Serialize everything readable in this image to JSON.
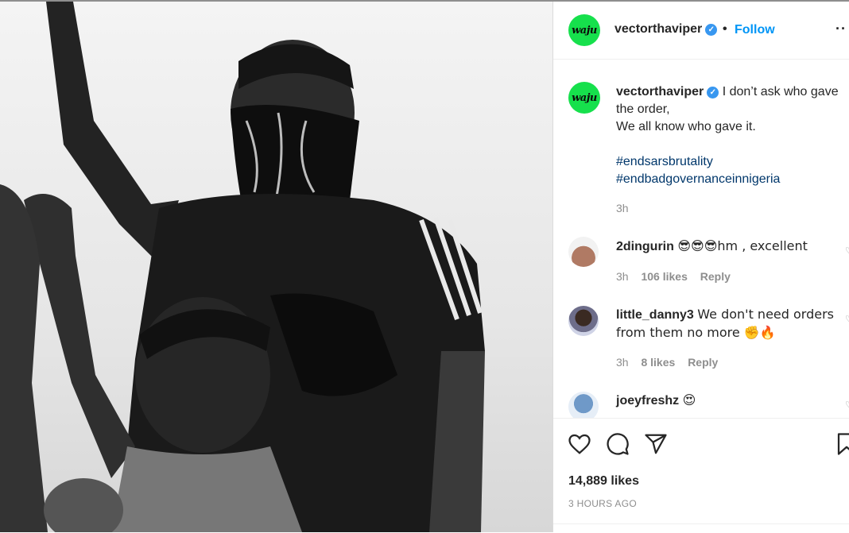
{
  "post": {
    "username": "vectorthaviper",
    "avatar_text": "waju",
    "follow_label": "Follow",
    "separator": "•",
    "more_label": "··",
    "caption": {
      "line1": "I don’t ask who gave the order,",
      "line2": "We all know who gave it.",
      "hashtags": [
        "#endsarsbrutality",
        "#endbadgovernanceinnigeria"
      ],
      "time": "3h"
    },
    "comments": [
      {
        "username": "2dingurin",
        "text": "😎😎😎hm , excellent",
        "time": "3h",
        "likes": "106 likes",
        "reply": "Reply"
      },
      {
        "username": "little_danny3",
        "text": "We don't need orders from them no more ✊🔥",
        "time": "3h",
        "likes": "8 likes",
        "reply": "Reply"
      },
      {
        "username": "joeyfreshz",
        "text": "😍"
      }
    ],
    "likes_count": "14,889 likes",
    "time_ago": "3 HOURS AGO"
  },
  "icons": {
    "verified": "verified-badge-icon",
    "like": "heart-icon",
    "comment": "comment-bubble-icon",
    "share": "paper-plane-icon",
    "save": "bookmark-icon"
  },
  "colors": {
    "follow": "#0095f6",
    "verified": "#3897f0",
    "avatar_bg": "#16e04c",
    "hashtag": "#00376b",
    "muted": "#8e8e8e"
  }
}
